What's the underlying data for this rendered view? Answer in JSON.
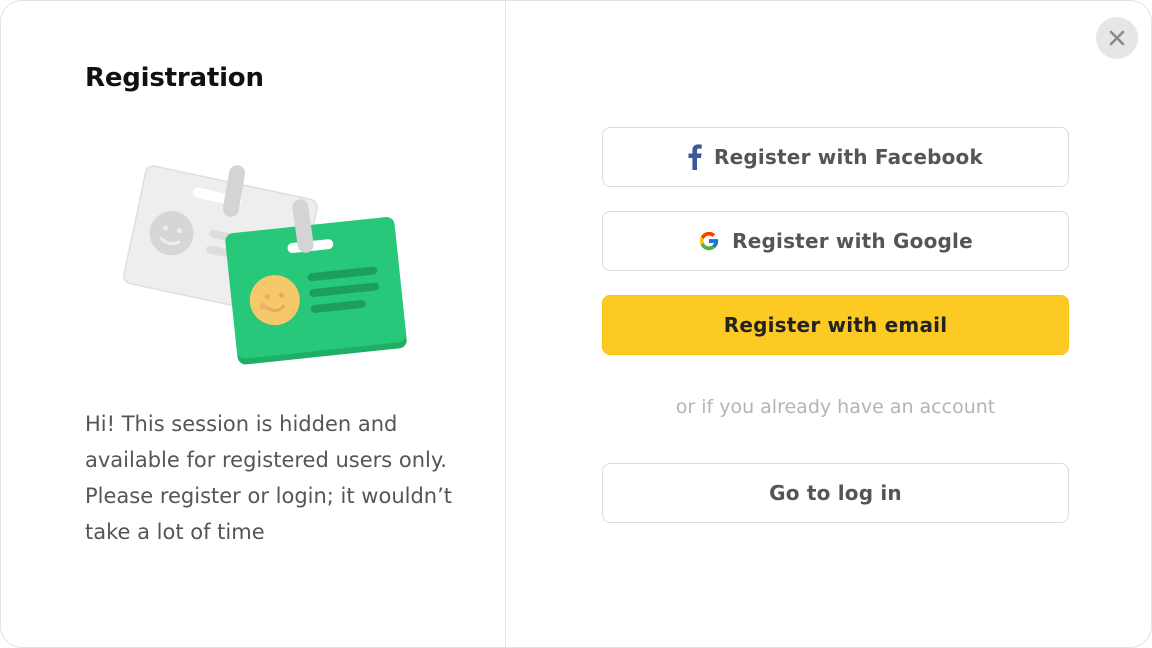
{
  "modal": {
    "title": "Registration",
    "description": "Hi! This session is hidden and available for registered users only. Please register or login; it wouldn’t take a lot of time",
    "close_icon": "close-icon"
  },
  "actions": {
    "facebook_label": "Register with Facebook",
    "google_label": "Register with Google",
    "email_label": "Register with email",
    "divider_text": "or if you already have an account",
    "login_label": "Go to log in"
  },
  "colors": {
    "accent": "#fcca22",
    "facebook": "#3b5998",
    "badge_green": "#27c87a",
    "face_yellow": "#f5c96a"
  }
}
